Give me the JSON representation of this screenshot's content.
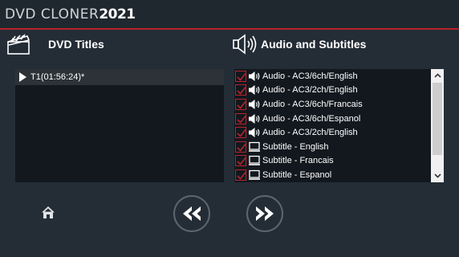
{
  "app": {
    "logo_text": "DVD CLONER",
    "logo_year": "2021",
    "accent_color": "#b8222a"
  },
  "dvd_titles": {
    "heading": "DVD Titles",
    "icon": "clapperboard-icon",
    "items": [
      {
        "label": "T1(01:56:24)*",
        "selected": true
      }
    ]
  },
  "audio_subtitles": {
    "heading": "Audio and Subtitles",
    "icon": "speaker-icon",
    "items": [
      {
        "type": "audio",
        "icon": "speaker-icon",
        "checked": true,
        "label": "Audio - AC3/6ch/English"
      },
      {
        "type": "audio",
        "icon": "speaker-icon",
        "checked": true,
        "label": "Audio - AC3/2ch/English"
      },
      {
        "type": "audio",
        "icon": "speaker-icon",
        "checked": true,
        "label": "Audio - AC3/6ch/Francais"
      },
      {
        "type": "audio",
        "icon": "speaker-icon",
        "checked": true,
        "label": "Audio - AC3/6ch/Espanol"
      },
      {
        "type": "audio",
        "icon": "speaker-icon",
        "checked": true,
        "label": "Audio - AC3/2ch/English"
      },
      {
        "type": "subtitle",
        "icon": "monitor-icon",
        "checked": true,
        "label": "Subtitle - English"
      },
      {
        "type": "subtitle",
        "icon": "monitor-icon",
        "checked": true,
        "label": "Subtitle - Francais"
      },
      {
        "type": "subtitle",
        "icon": "monitor-icon",
        "checked": true,
        "label": "Subtitle - Espanol"
      }
    ]
  },
  "footer": {
    "home_icon": "home-icon",
    "back_icon": "rewind-icon",
    "next_icon": "fast-forward-icon"
  }
}
